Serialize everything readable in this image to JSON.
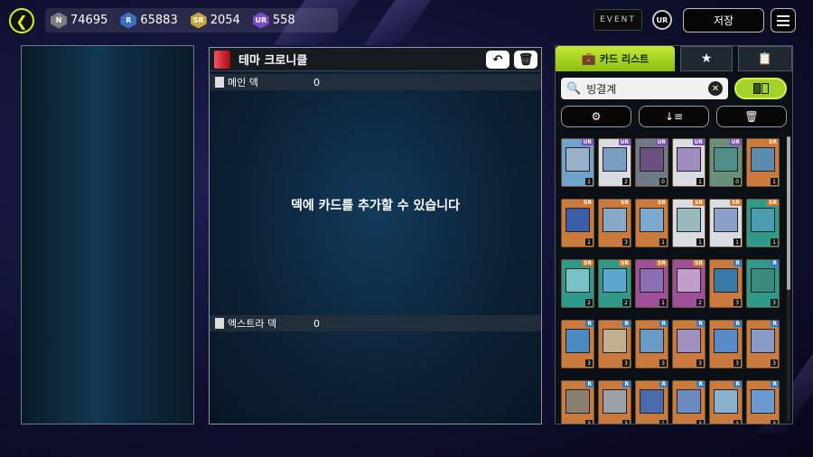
{
  "currencies": [
    {
      "rarity": "N",
      "value": "74695",
      "color": "#7d7d7d"
    },
    {
      "rarity": "R",
      "value": "65883",
      "color": "#3a6fc4"
    },
    {
      "rarity": "SR",
      "value": "2054",
      "color": "#c9a23a"
    },
    {
      "rarity": "UR",
      "value": "558",
      "color": "#7a4bc9"
    }
  ],
  "header": {
    "event_label": "EVENT",
    "ur_label": "UR",
    "save_label": "저장"
  },
  "deck": {
    "title": "테마 크로니클",
    "main_label": "메인 덱",
    "main_count": "0",
    "extra_label": "엑스트라 덱",
    "extra_count": "0",
    "empty_message": "덱에 카드를 추가할 수 있습니다"
  },
  "card_list": {
    "tab_label": "카드 리스트",
    "search_value": "빙결계"
  },
  "cards": [
    {
      "rarity": "UR",
      "count": "1",
      "frame": "#6fa3c9",
      "art": "#9ab0c8",
      "type": "synchro"
    },
    {
      "rarity": "UR",
      "count": "2",
      "frame": "#d9dde2",
      "art": "#7a9fc0",
      "type": "synchro"
    },
    {
      "rarity": "UR",
      "count": "0",
      "frame": "#6e7a86",
      "art": "#6a4f80",
      "type": "synchro"
    },
    {
      "rarity": "UR",
      "count": "1",
      "frame": "#d9dde2",
      "art": "#a08cc0",
      "type": "synchro"
    },
    {
      "rarity": "UR",
      "count": "0",
      "frame": "#6a8f7a",
      "art": "#4f8c8a",
      "type": "spell"
    },
    {
      "rarity": "SR",
      "count": "1",
      "frame": "#c97a3c",
      "art": "#5a8cb0",
      "type": "effect"
    },
    {
      "rarity": "SR",
      "count": "1",
      "frame": "#c97a3c",
      "art": "#3a5fa8",
      "type": "effect"
    },
    {
      "rarity": "SR",
      "count": "3",
      "frame": "#c97a3c",
      "art": "#8aa8c8",
      "type": "effect"
    },
    {
      "rarity": "SR",
      "count": "1",
      "frame": "#c97a3c",
      "art": "#7aa8d0",
      "type": "effect"
    },
    {
      "rarity": "SR",
      "count": "1",
      "frame": "#d9dde2",
      "art": "#9ab8c0",
      "type": "synchro"
    },
    {
      "rarity": "SR",
      "count": "1",
      "frame": "#d9dde2",
      "art": "#8aa0c8",
      "type": "synchro"
    },
    {
      "rarity": "SR",
      "count": "1",
      "frame": "#2f9a8a",
      "art": "#4a9ab0",
      "type": "spell"
    },
    {
      "rarity": "SR",
      "count": "2",
      "frame": "#2f9a8a",
      "art": "#7ac0c8",
      "type": "spell"
    },
    {
      "rarity": "SR",
      "count": "2",
      "frame": "#2f9a8a",
      "art": "#5aa8d0",
      "type": "spell"
    },
    {
      "rarity": "SR",
      "count": "1",
      "frame": "#a0509a",
      "art": "#8a70b0",
      "type": "trap"
    },
    {
      "rarity": "SR",
      "count": "2",
      "frame": "#a0509a",
      "art": "#c0a0c8",
      "type": "trap"
    },
    {
      "rarity": "R",
      "count": "3",
      "frame": "#c97a3c",
      "art": "#3a7aa8",
      "type": "effect"
    },
    {
      "rarity": "R",
      "count": "3",
      "frame": "#2f9a8a",
      "art": "#3a8a80",
      "type": "spell"
    },
    {
      "rarity": "R",
      "count": "3",
      "frame": "#c97a3c",
      "art": "#4a8ac0",
      "type": "effect"
    },
    {
      "rarity": "R",
      "count": "3",
      "frame": "#c97a3c",
      "art": "#c0b090",
      "type": "effect"
    },
    {
      "rarity": "R",
      "count": "3",
      "frame": "#c97a3c",
      "art": "#6a9ac8",
      "type": "effect"
    },
    {
      "rarity": "R",
      "count": "3",
      "frame": "#c97a3c",
      "art": "#a090c0",
      "type": "effect"
    },
    {
      "rarity": "R",
      "count": "3",
      "frame": "#c97a3c",
      "art": "#5a8ac8",
      "type": "effect"
    },
    {
      "rarity": "R",
      "count": "3",
      "frame": "#c97a3c",
      "art": "#8a9ac8",
      "type": "effect"
    },
    {
      "rarity": "R",
      "count": "3",
      "frame": "#c97a3c",
      "art": "#8a8070",
      "type": "effect"
    },
    {
      "rarity": "R",
      "count": "3",
      "frame": "#c97a3c",
      "art": "#9aa0a8",
      "type": "effect"
    },
    {
      "rarity": "R",
      "count": "1",
      "frame": "#c97a3c",
      "art": "#4a6ab0",
      "type": "effect"
    },
    {
      "rarity": "R",
      "count": "3",
      "frame": "#c97a3c",
      "art": "#6a8ac0",
      "type": "effect"
    },
    {
      "rarity": "R",
      "count": "3",
      "frame": "#c97a3c",
      "art": "#8ab0d0",
      "type": "effect"
    },
    {
      "rarity": "R",
      "count": "3",
      "frame": "#c97a3c",
      "art": "#6a9ad0",
      "type": "effect"
    }
  ],
  "colors": {
    "accent": "#c7e838",
    "rarity_UR": "#7a4bc9",
    "rarity_SR": "#d9742a",
    "rarity_R": "#2f78d0"
  },
  "icons": {
    "back": "chevron-left-icon",
    "undo": "undo-icon",
    "trash": "trash-icon",
    "briefcase": "briefcase-icon",
    "star": "star-icon",
    "clipboard": "clipboard-icon",
    "search": "search-icon",
    "clear": "close-icon",
    "filter": "filter-sliders-icon",
    "sort": "sort-icon",
    "menu": "menu-icon"
  }
}
